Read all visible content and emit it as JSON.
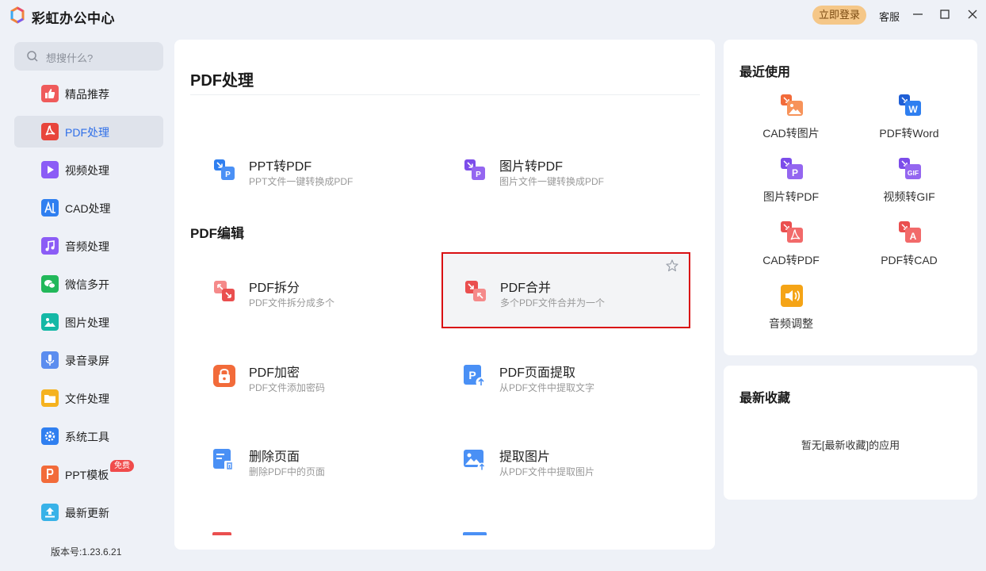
{
  "window": {
    "title": "彩虹办公中心",
    "login_label": "立即登录",
    "service_label": "客服"
  },
  "sidebar": {
    "search_placeholder": "想搜什么?",
    "items": [
      {
        "label": "精品推荐",
        "icon": "thumbs-up-icon"
      },
      {
        "label": "PDF处理",
        "icon": "pdf-icon",
        "active": true
      },
      {
        "label": "视频处理",
        "icon": "video-play-icon"
      },
      {
        "label": "CAD处理",
        "icon": "cad-icon"
      },
      {
        "label": "音频处理",
        "icon": "music-note-icon"
      },
      {
        "label": "微信多开",
        "icon": "wechat-icon"
      },
      {
        "label": "图片处理",
        "icon": "image-icon"
      },
      {
        "label": "录音录屏",
        "icon": "microphone-icon"
      },
      {
        "label": "文件处理",
        "icon": "folder-icon"
      },
      {
        "label": "系统工具",
        "icon": "gear-icon"
      },
      {
        "label": "PPT模板",
        "icon": "ppt-icon",
        "badge": "免费"
      },
      {
        "label": "最新更新",
        "icon": "upload-icon"
      }
    ],
    "version": "版本号:1.23.6.21"
  },
  "main": {
    "page_title": "PDF处理",
    "convert_tools": [
      {
        "name": "PPT转PDF",
        "desc": "PPT文件一键转换成PDF",
        "icon": "ppt-to-pdf-icon"
      },
      {
        "name": "图片转PDF",
        "desc": "图片文件一键转换成PDF",
        "icon": "image-to-pdf-icon"
      }
    ],
    "edit_section_title": "PDF编辑",
    "edit_tools": [
      {
        "name": "PDF拆分",
        "desc": "PDF文件拆分成多个",
        "icon": "pdf-split-icon"
      },
      {
        "name": "PDF合并",
        "desc": "多个PDF文件合并为一个",
        "icon": "pdf-merge-icon",
        "selected": true
      },
      {
        "name": "PDF加密",
        "desc": "PDF文件添加密码",
        "icon": "pdf-lock-icon"
      },
      {
        "name": "PDF页面提取",
        "desc": "从PDF文件中提取文字",
        "icon": "pdf-page-extract-icon"
      },
      {
        "name": "删除页面",
        "desc": "删除PDF中的页面",
        "icon": "delete-page-icon"
      },
      {
        "name": "提取图片",
        "desc": "从PDF文件中提取图片",
        "icon": "extract-image-icon"
      }
    ]
  },
  "recent": {
    "title": "最近使用",
    "items": [
      {
        "label": "CAD转图片",
        "icon": "cad-to-image-icon"
      },
      {
        "label": "PDF转Word",
        "icon": "pdf-to-word-icon"
      },
      {
        "label": "图片转PDF",
        "icon": "image-to-pdf-icon"
      },
      {
        "label": "视频转GIF",
        "icon": "video-to-gif-icon"
      },
      {
        "label": "CAD转PDF",
        "icon": "cad-to-pdf-icon"
      },
      {
        "label": "PDF转CAD",
        "icon": "pdf-to-cad-icon"
      },
      {
        "label": "音频调整",
        "icon": "audio-adjust-icon"
      }
    ]
  },
  "favorites": {
    "title": "最新收藏",
    "empty_text": "暂无[最新收藏]的应用"
  },
  "colors": {
    "accent": "#2f6fe8",
    "login_button": "#f5c788",
    "selection_border": "#d90f12",
    "badge": "#f04b4b"
  }
}
